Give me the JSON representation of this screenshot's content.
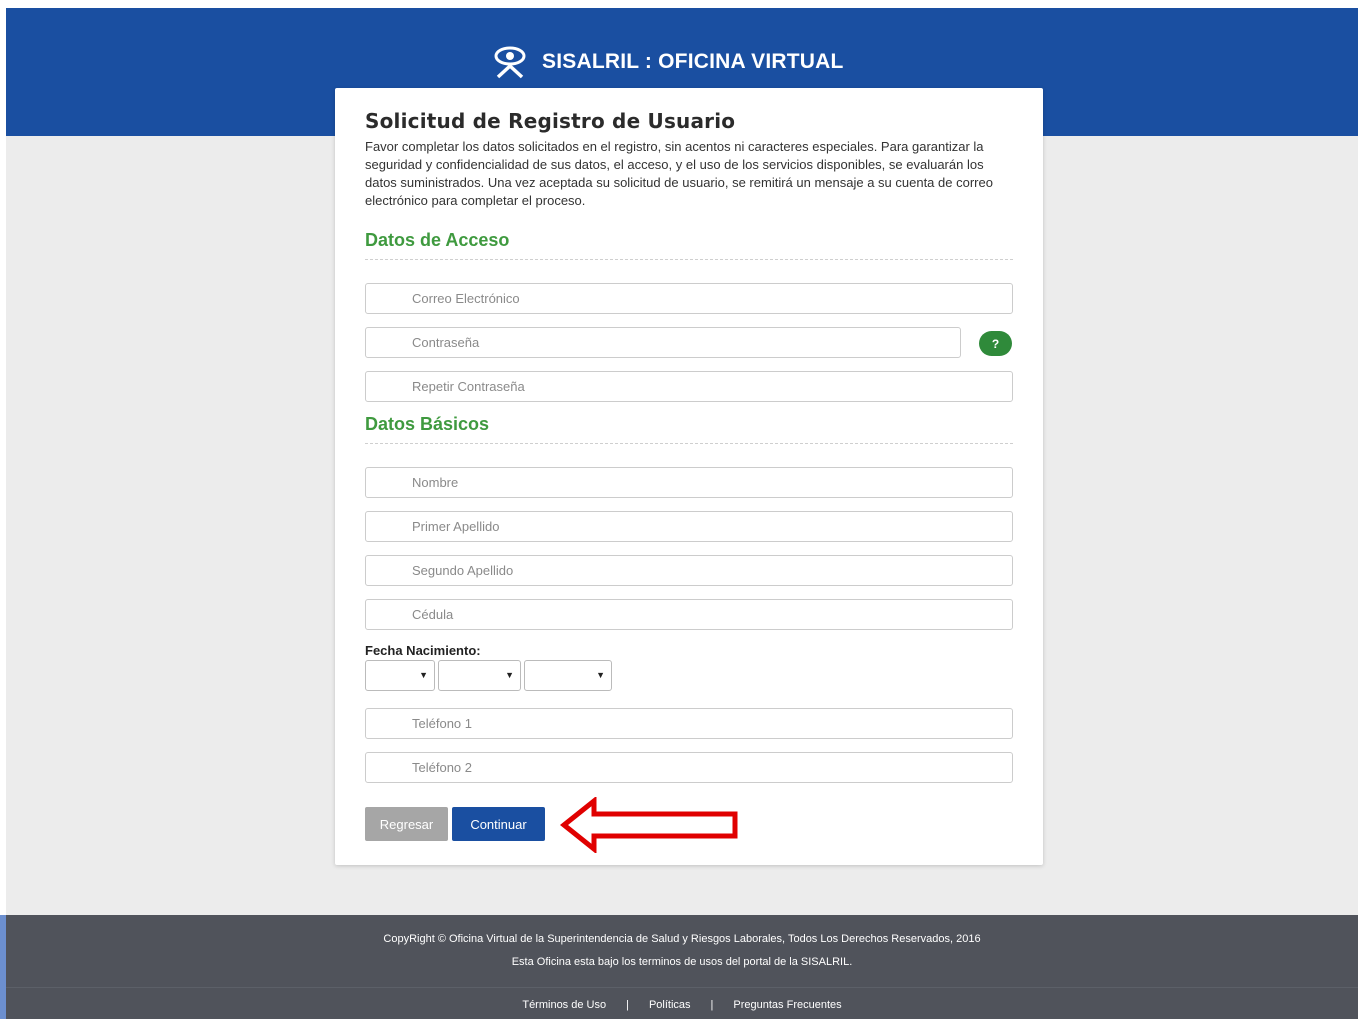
{
  "header": {
    "brand_title": "SISALRIL : OFICINA VIRTUAL",
    "logo_icon": "sisalril-logo-icon",
    "color": "#1a4fa1"
  },
  "form": {
    "title": "Solicitud de Registro de Usuario",
    "intro": "Favor completar los datos solicitados en el registro, sin acentos ni caracteres especiales. Para garantizar la seguridad y confidencialidad de sus datos, el acceso, y el uso de los servicios disponibles, se evaluarán los datos suministrados. Una vez aceptada su solicitud de usuario, se remitirá un mensaje a su cuenta de correo electrónico para completar el proceso.",
    "access_section": {
      "title": "Datos de Acceso",
      "email_placeholder": "Correo Electrónico",
      "password_placeholder": "Contraseña",
      "password_help_label": "?",
      "repeat_password_placeholder": "Repetir Contraseña"
    },
    "basic_section": {
      "title": "Datos Básicos",
      "name_placeholder": "Nombre",
      "first_surname_placeholder": "Primer Apellido",
      "second_surname_placeholder": "Segundo Apellido",
      "id_placeholder": "Cédula",
      "dob_label": "Fecha Nacimiento:",
      "dob_day": "",
      "dob_month": "",
      "dob_year": "",
      "phone1_placeholder": "Teléfono 1",
      "phone2_placeholder": "Teléfono 2"
    },
    "buttons": {
      "back_label": "Regresar",
      "continue_label": "Continuar"
    },
    "accent_green": "#3f9a3f"
  },
  "annotation": {
    "arrow_color": "#e00000",
    "arrow_icon": "left-arrow-annotation"
  },
  "footer": {
    "copyright": "CopyRight © Oficina Virtual de la Superintendencia de Salud y Riesgos Laborales, Todos Los Derechos Reservados, 2016",
    "terms_note": "Esta Oficina esta bajo los terminos de usos del portal de la SISALRIL.",
    "links": [
      "Términos de Uso",
      "Políticas",
      "Preguntas Frecuentes"
    ],
    "separator": "|",
    "color": "#50535b"
  }
}
